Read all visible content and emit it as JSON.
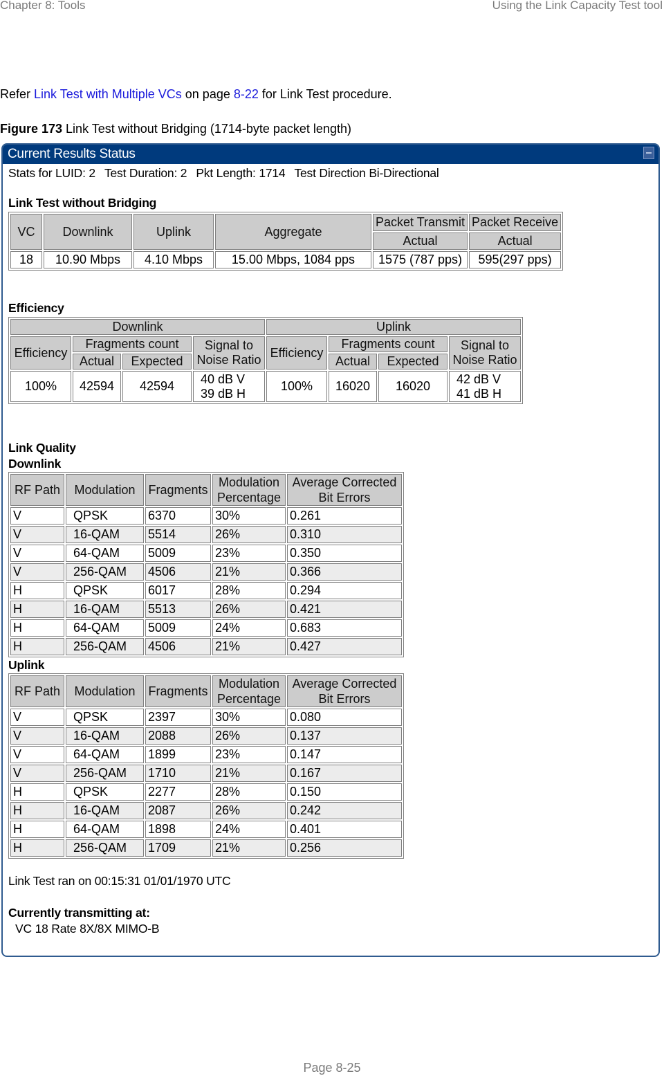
{
  "page_header": {
    "chapter": "Chapter 8:  Tools",
    "section": "Using the Link Capacity Test tool"
  },
  "intro": {
    "prefix": "Refer ",
    "link_text": "Link Test with Multiple VCs",
    "middle": " on page ",
    "page_link": "8-22",
    "suffix": " for Link Test procedure."
  },
  "caption": {
    "label": "Figure 173",
    "text": " Link Test without Bridging (1714-byte packet length)"
  },
  "panel": {
    "title": "Current Results Status",
    "collapse_icon": "minimize-icon",
    "stats": {
      "luid": "Stats for LUID: 2",
      "duration": "Test Duration: 2",
      "pkt_length": "Pkt Length: 1714",
      "direction": "Test Direction Bi-Directional"
    },
    "link_test": {
      "title": "Link Test without Bridging",
      "headers": {
        "vc": "VC",
        "downlink": "Downlink",
        "uplink": "Uplink",
        "aggregate": "Aggregate",
        "packet_transmit": "Packet Transmit",
        "packet_receive": "Packet Receive",
        "actual_tx": "Actual",
        "actual_rx": "Actual"
      },
      "row": {
        "vc": "18",
        "downlink": "10.90 Mbps",
        "uplink": "4.10 Mbps",
        "aggregate": "15.00 Mbps,  1084 pps",
        "packet_transmit": "1575 (787 pps)",
        "packet_receive": "595(297 pps)"
      }
    },
    "efficiency": {
      "title": "Efficiency",
      "downlink": {
        "group": "Downlink",
        "efficiency_header": "Efficiency",
        "fragments_header": "Fragments count",
        "actual_header": "Actual",
        "expected_header": "Expected",
        "snr_header": "Signal to Noise Ratio",
        "efficiency": "100%",
        "actual": "42594",
        "expected": "42594",
        "snr_v": "40 dB V",
        "snr_h": "39 dB H"
      },
      "uplink": {
        "group": "Uplink",
        "efficiency_header": "Efficiency",
        "fragments_header": "Fragments count",
        "actual_header": "Actual",
        "expected_header": "Expected",
        "snr_header": "Signal to Noise Ratio",
        "efficiency": "100%",
        "actual": "16020",
        "expected": "16020",
        "snr_v": "42 dB V",
        "snr_h": "41 dB H"
      }
    },
    "link_quality": {
      "title": "Link Quality",
      "headers": [
        "RF Path",
        "Modulation",
        "Fragments",
        "Modulation Percentage",
        "Average Corrected Bit Errors"
      ],
      "downlink": {
        "title": "Downlink",
        "rows": [
          [
            "V",
            "QPSK",
            "6370",
            "30%",
            "0.261"
          ],
          [
            "V",
            "16-QAM",
            "5514",
            "26%",
            "0.310"
          ],
          [
            "V",
            "64-QAM",
            "5009",
            "23%",
            "0.350"
          ],
          [
            "V",
            "256-QAM",
            "4506",
            "21%",
            "0.366"
          ],
          [
            "H",
            "QPSK",
            "6017",
            "28%",
            "0.294"
          ],
          [
            "H",
            "16-QAM",
            "5513",
            "26%",
            "0.421"
          ],
          [
            "H",
            "64-QAM",
            "5009",
            "24%",
            "0.683"
          ],
          [
            "H",
            "256-QAM",
            "4506",
            "21%",
            "0.427"
          ]
        ]
      },
      "uplink": {
        "title": "Uplink",
        "rows": [
          [
            "V",
            "QPSK",
            "2397",
            "30%",
            "0.080"
          ],
          [
            "V",
            "16-QAM",
            "2088",
            "26%",
            "0.137"
          ],
          [
            "V",
            "64-QAM",
            "1899",
            "23%",
            "0.147"
          ],
          [
            "V",
            "256-QAM",
            "1710",
            "21%",
            "0.167"
          ],
          [
            "H",
            "QPSK",
            "2277",
            "28%",
            "0.150"
          ],
          [
            "H",
            "16-QAM",
            "2087",
            "26%",
            "0.242"
          ],
          [
            "H",
            "64-QAM",
            "1898",
            "24%",
            "0.401"
          ],
          [
            "H",
            "256-QAM",
            "1709",
            "21%",
            "0.256"
          ]
        ]
      }
    },
    "ran_on": "Link Test ran on 00:15:31 01/01/1970 UTC",
    "transmitting": {
      "title": "Currently transmitting at:",
      "value": "VC 18 Rate 8X/8X MIMO-B"
    }
  },
  "page_footer": "Page 8-25",
  "colors": {
    "panel_header": "#003a7d",
    "header_cell": "#cccccc",
    "alt_row": "#ececec",
    "link": "#1a1adb"
  }
}
